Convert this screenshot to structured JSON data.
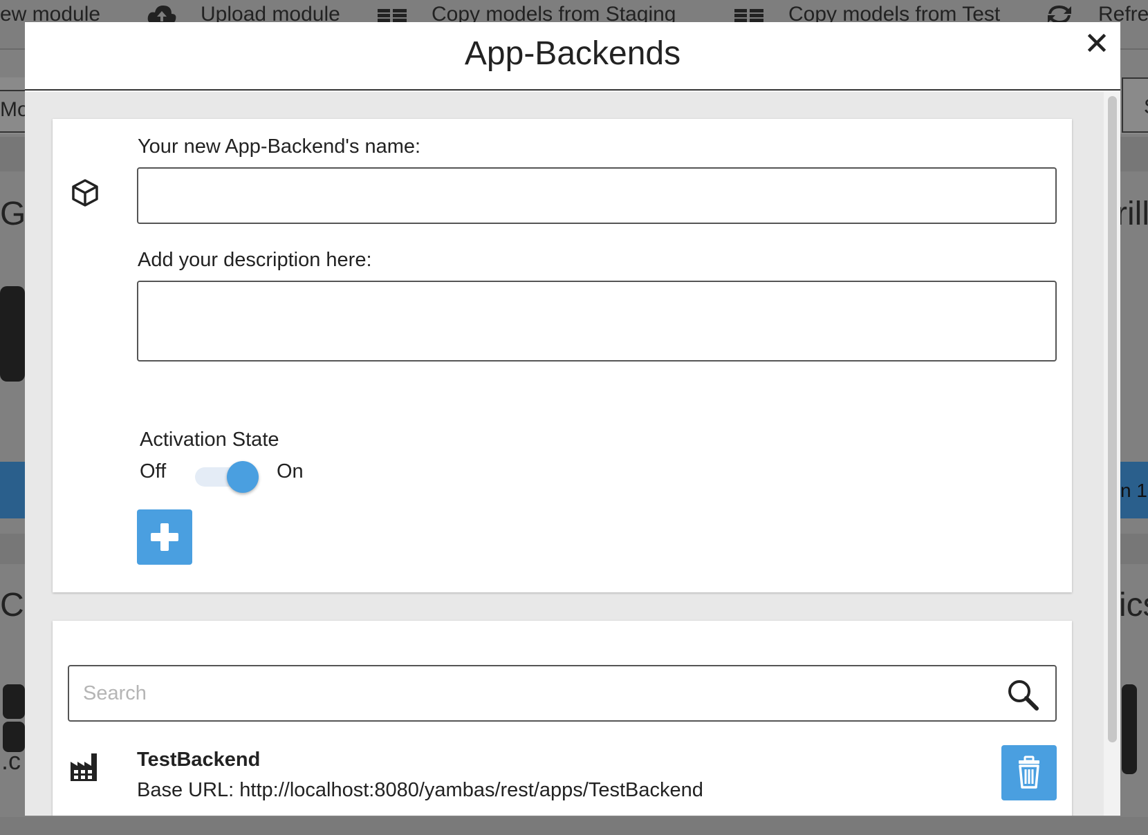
{
  "background": {
    "toolbar": [
      {
        "label": "ew module",
        "icon": "module-icon"
      },
      {
        "label": "Upload module",
        "icon": "cloud-upload-icon"
      },
      {
        "label": "Copy models from Staging",
        "icon": "copy-models-icon"
      },
      {
        "label": "Copy models from Test",
        "icon": "copy-models-icon"
      },
      {
        "label": "Refres",
        "icon": "refresh-icon"
      }
    ],
    "fragments": {
      "left_tab": "Mod",
      "left_heading_1": "G",
      "left_heading_2": "C",
      "left_small": ".c",
      "right_tab": "S",
      "right_heading_1": "rill",
      "right_heading_2": "ics",
      "right_button": "n 1"
    }
  },
  "modal": {
    "title": "App-Backends",
    "close_icon": "close-icon",
    "form": {
      "name_label": "Your new App-Backend's name:",
      "name_value": "",
      "description_label": "Add your description here:",
      "description_value": "",
      "activation_label": "Activation State",
      "toggle_off_label": "Off",
      "toggle_on_label": "On",
      "activation_on": true,
      "add_icon": "plus-icon"
    },
    "list": {
      "search_placeholder": "Search",
      "search_value": "",
      "items": [
        {
          "name": "TestBackend",
          "url_label": "Base URL:",
          "url": "http://localhost:8080/yambas/rest/apps/TestBackend",
          "icon": "factory-icon",
          "delete_icon": "trash-icon"
        }
      ]
    }
  },
  "colors": {
    "accent": "#4a9fe0",
    "overlay": "#808080",
    "modal_body": "#e8e8e8"
  }
}
